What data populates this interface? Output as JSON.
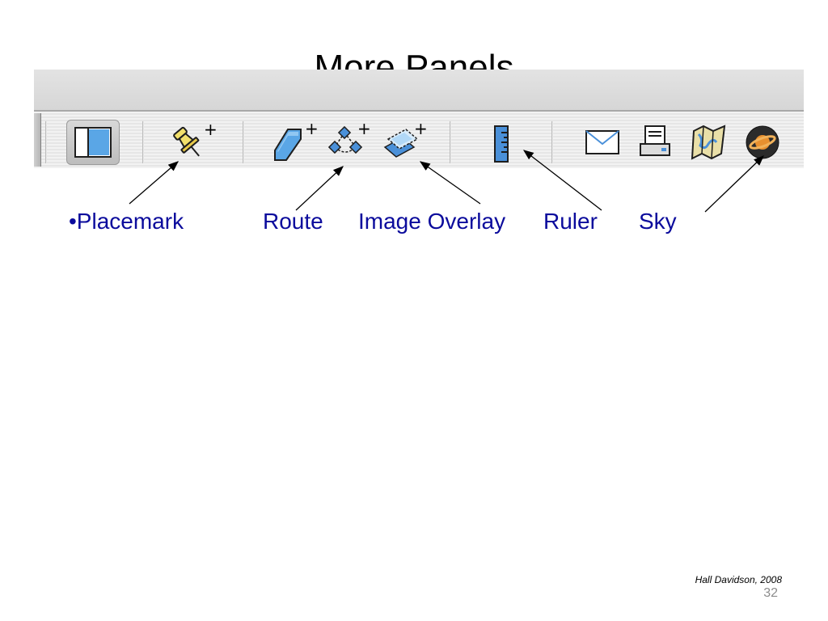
{
  "slide": {
    "title": "More Panels",
    "credit": "Hall Davidson, 2008",
    "page_number": "32"
  },
  "toolbar": {
    "buttons": [
      {
        "name": "sidebar-toggle",
        "icon": "sidebar-toggle-icon"
      },
      {
        "name": "add-placemark",
        "icon": "pushpin-icon"
      },
      {
        "name": "add-polygon",
        "icon": "polygon-icon"
      },
      {
        "name": "add-path",
        "icon": "path-icon"
      },
      {
        "name": "add-image-overlay",
        "icon": "image-overlay-icon"
      },
      {
        "name": "ruler",
        "icon": "ruler-icon"
      },
      {
        "name": "email",
        "icon": "envelope-icon"
      },
      {
        "name": "print",
        "icon": "printer-icon"
      },
      {
        "name": "view-in-maps",
        "icon": "map-icon"
      },
      {
        "name": "switch-to-sky",
        "icon": "saturn-icon"
      }
    ]
  },
  "labels": {
    "placemark": "•Placemark",
    "route": "Route",
    "image_overlay": "Image Overlay",
    "ruler": "Ruler",
    "sky": "Sky"
  },
  "colors": {
    "label_text": "#0b0b9c",
    "icon_blue": "#4a90d9",
    "pin_yellow": "#f2e06b"
  }
}
